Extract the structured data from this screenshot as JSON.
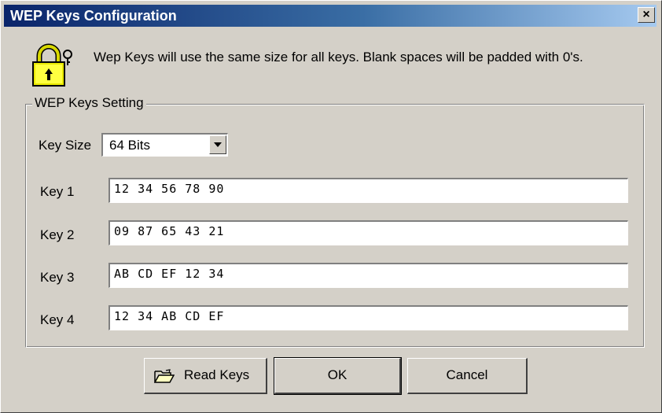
{
  "window": {
    "title": "WEP Keys Configuration",
    "close_label": "×"
  },
  "info": {
    "text": "Wep Keys will use the same size for all keys. Blank spaces will be padded with 0's.",
    "icon": "lock-icon"
  },
  "group": {
    "legend": "WEP Keys Setting"
  },
  "key_size": {
    "label": "Key Size",
    "value": "64 Bits"
  },
  "keys": [
    {
      "label": "Key 1",
      "value": "12 34 56 78 90"
    },
    {
      "label": "Key 2",
      "value": "09 87 65 43 21"
    },
    {
      "label": "Key 3",
      "value": "AB CD EF 12 34"
    },
    {
      "label": "Key 4",
      "value": "12 34 AB CD EF"
    }
  ],
  "buttons": {
    "read_keys": "Read Keys",
    "ok": "OK",
    "cancel": "Cancel"
  },
  "colors": {
    "title_bar_start": "#0a246a",
    "title_bar_end": "#a6caf0",
    "dialog_face": "#d4d0c8"
  }
}
